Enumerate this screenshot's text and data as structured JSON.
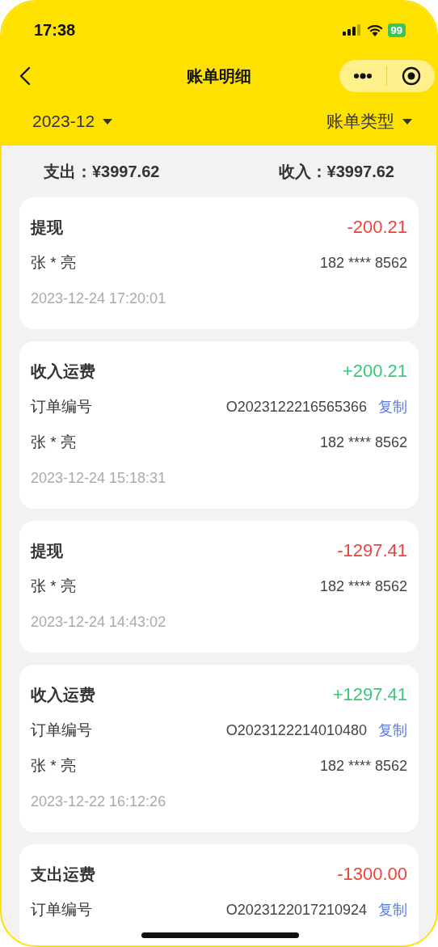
{
  "status_bar": {
    "time": "17:38",
    "battery": "99"
  },
  "nav": {
    "title": "账单明细"
  },
  "filters": [
    {
      "label": "2023-12"
    },
    {
      "label": "账单类型"
    }
  ],
  "summary": [
    {
      "label": "支出：",
      "value": "¥3997.62"
    },
    {
      "label": "收入：",
      "value": "¥3997.62"
    }
  ],
  "records": [
    {
      "title": "提现",
      "color": "#e8453c",
      "amount": "-200.21",
      "name": "张 * 亮",
      "phone": "182 **** 8562",
      "time": "2023-12-24 17:20:01"
    },
    {
      "title": "收入运费",
      "color": "#3cc87a",
      "amount": "+200.21",
      "order_label": "订单编号",
      "order_no": "O2023122216565366",
      "copy": "复制",
      "name": "张 * 亮",
      "phone": "182 **** 8562",
      "time": "2023-12-24 15:18:31"
    },
    {
      "title": "提现",
      "color": "#e8453c",
      "amount": "-1297.41",
      "name": "张 * 亮",
      "phone": "182 **** 8562",
      "time": "2023-12-24 14:43:02"
    },
    {
      "title": "收入运费",
      "color": "#3cc87a",
      "amount": "+1297.41",
      "order_label": "订单编号",
      "order_no": "O2023122214010480",
      "copy": "复制",
      "name": "张 * 亮",
      "phone": "182 **** 8562",
      "time": "2023-12-22 16:12:26"
    },
    {
      "title": "支出运费",
      "color": "#e8453c",
      "amount": "-1300.00",
      "order_label": "订单编号",
      "order_no": "O2023122017210924",
      "copy": "复制"
    }
  ]
}
